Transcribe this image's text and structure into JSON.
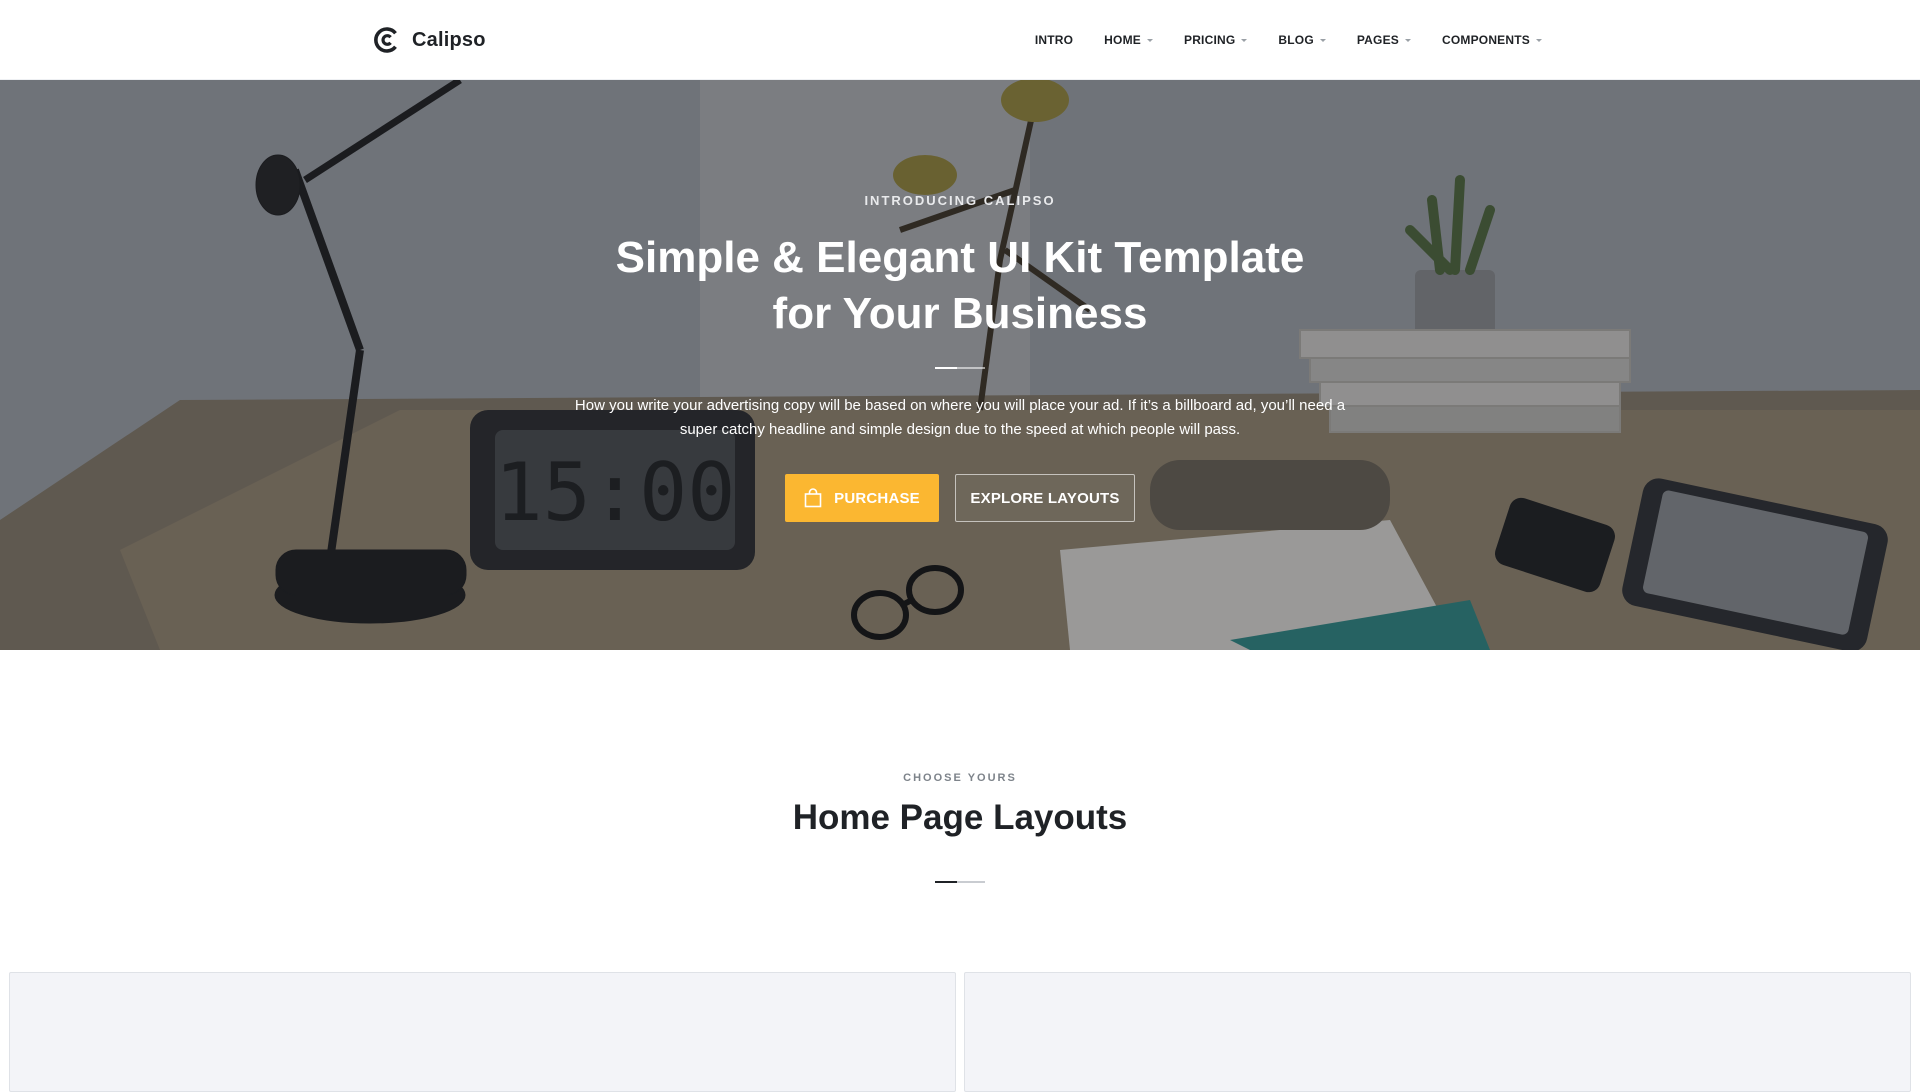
{
  "brand": {
    "name": "Calipso",
    "logo_icon": "calipso-c-logo-icon"
  },
  "nav": {
    "items": [
      {
        "label": "INTRO",
        "has_dropdown": false
      },
      {
        "label": "HOME",
        "has_dropdown": true
      },
      {
        "label": "PRICING",
        "has_dropdown": true
      },
      {
        "label": "BLOG",
        "has_dropdown": true
      },
      {
        "label": "PAGES",
        "has_dropdown": true
      },
      {
        "label": "COMPONENTS",
        "has_dropdown": true
      }
    ]
  },
  "hero": {
    "eyebrow": "INTRODUCING CALIPSO",
    "title_line1": "Simple & Elegant UI Kit Template",
    "title_line2": "for Your Business",
    "description": "How you write your advertising copy will be based on where you will place your ad. If it’s a billboard ad, you’ll need a super catchy headline and simple design due to the speed at which people will pass.",
    "primary_button": {
      "label": "PURCHASE",
      "icon": "shopping-bag-icon"
    },
    "secondary_button": {
      "label": "EXPLORE LAYOUTS"
    },
    "clock_display": "15:00"
  },
  "layouts_section": {
    "eyebrow": "CHOOSE YOURS",
    "title": "Home Page Layouts"
  },
  "colors": {
    "accent": "#fbb731",
    "text_dark": "#1f2226",
    "card_bg": "#f3f4f8"
  }
}
